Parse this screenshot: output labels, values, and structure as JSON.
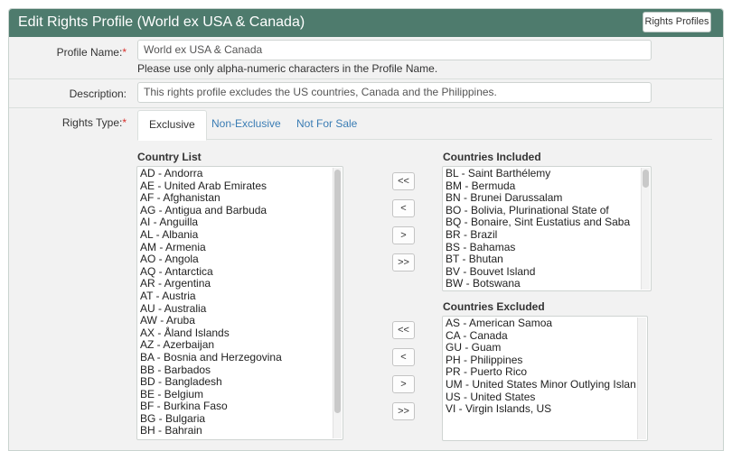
{
  "header": {
    "title": "Edit Rights Profile (World ex USA & Canada)",
    "profiles_button": "Rights Profiles"
  },
  "form": {
    "profile_name_label": "Profile Name:",
    "required_mark": "*",
    "profile_name_value": "World ex USA & Canada",
    "profile_name_help": "Please use only alpha-numeric characters in the Profile Name.",
    "description_label": "Description:",
    "description_value": "This rights profile excludes the US countries, Canada and the Philippines.",
    "rights_type_label": "Rights Type:"
  },
  "tabs": [
    {
      "label": "Exclusive",
      "active": true
    },
    {
      "label": "Non-Exclusive",
      "active": false
    },
    {
      "label": "Not For Sale",
      "active": false
    }
  ],
  "country_list": {
    "title": "Country List",
    "items": [
      "AD - Andorra",
      "AE - United Arab Emirates",
      "AF - Afghanistan",
      "AG - Antigua and Barbuda",
      "AI - Anguilla",
      "AL - Albania",
      "AM - Armenia",
      "AO - Angola",
      "AQ - Antarctica",
      "AR - Argentina",
      "AT - Austria",
      "AU - Australia",
      "AW - Aruba",
      "AX - Åland Islands",
      "AZ - Azerbaijan",
      "BA - Bosnia and Herzegovina",
      "BB - Barbados",
      "BD - Bangladesh",
      "BE - Belgium",
      "BF - Burkina Faso",
      "BG - Bulgaria",
      "BH - Bahrain"
    ]
  },
  "countries_included": {
    "title": "Countries Included",
    "items": [
      "BL - Saint Barthélemy",
      "BM - Bermuda",
      "BN - Brunei Darussalam",
      "BO - Bolivia, Plurinational State of",
      "BQ - Bonaire, Sint Eustatius and Saba",
      "BR - Brazil",
      "BS - Bahamas",
      "BT - Bhutan",
      "BV - Bouvet Island",
      "BW - Botswana"
    ]
  },
  "countries_excluded": {
    "title": "Countries Excluded",
    "items": [
      "AS - American Samoa",
      "CA - Canada",
      "GU - Guam",
      "PH - Philippines",
      "PR - Puerto Rico",
      "UM - United States Minor Outlying Islands",
      "US - United States",
      "VI - Virgin Islands, US"
    ]
  },
  "move_buttons": {
    "remove_all": "<<",
    "remove": "<",
    "add": ">",
    "add_all": ">>"
  }
}
